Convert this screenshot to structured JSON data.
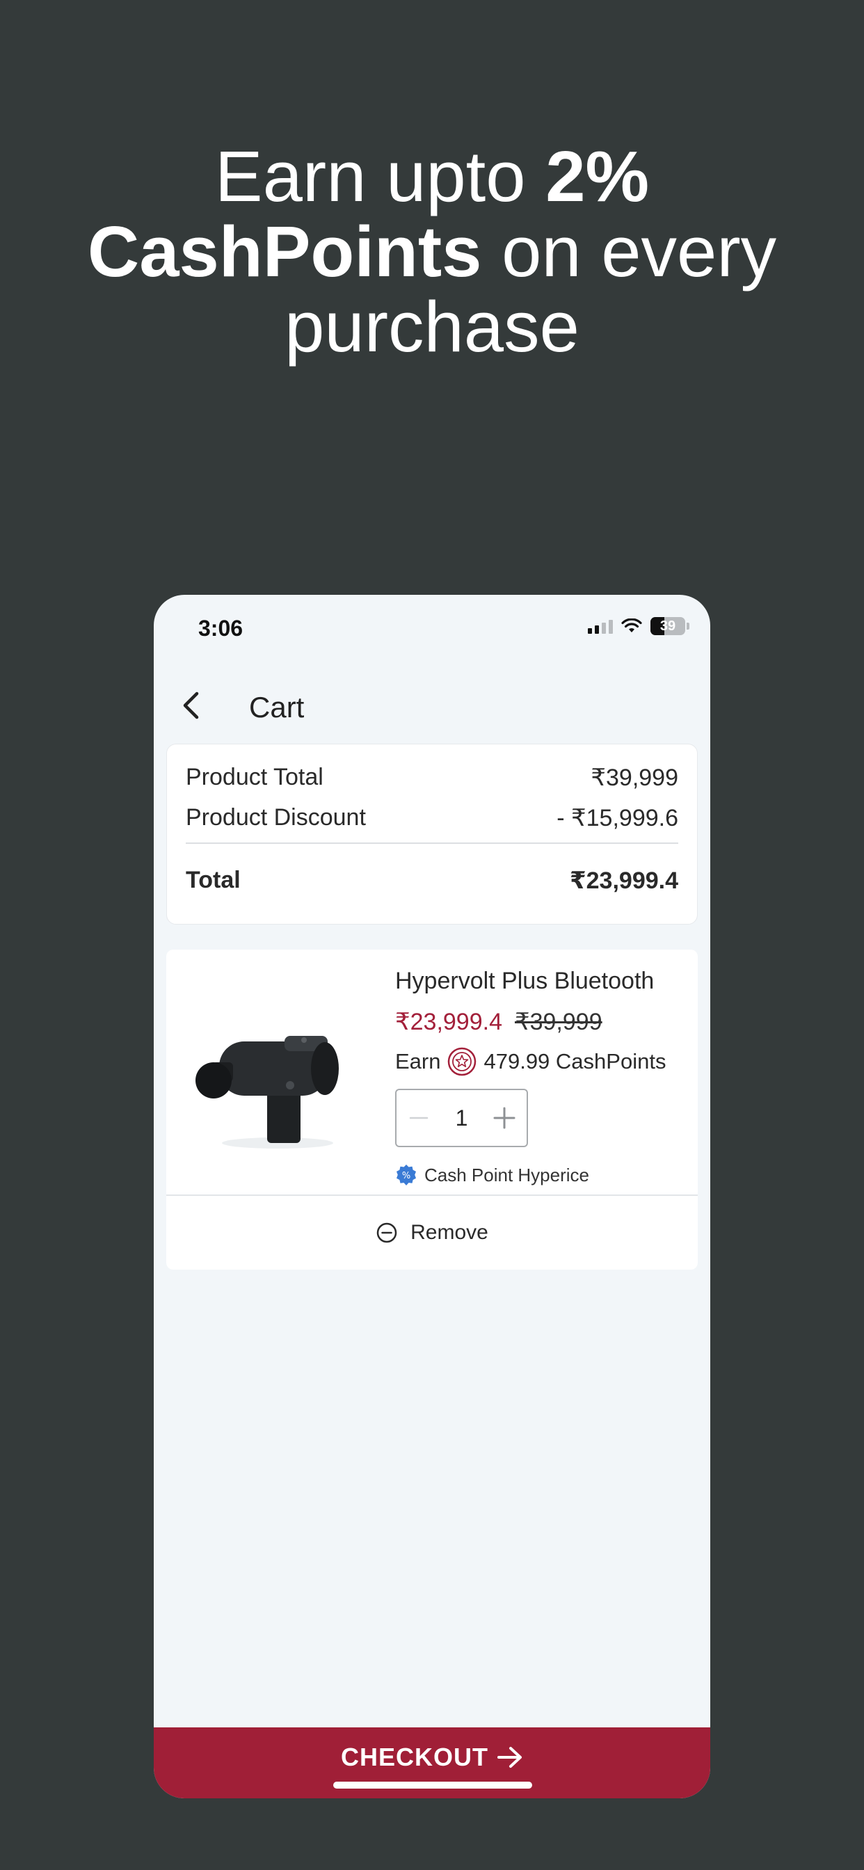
{
  "promo": {
    "part1": "Earn upto ",
    "bold1": "2%",
    "bold2": "CashPoints",
    "part2": " on every",
    "part3": "purchase"
  },
  "status_bar": {
    "time": "3:06",
    "battery": "39"
  },
  "header": {
    "title": "Cart"
  },
  "summary": {
    "rows": [
      {
        "label": "Product Total",
        "value": "₹39,999"
      },
      {
        "label": "Product Discount",
        "value": "- ₹15,999.6"
      }
    ],
    "total_label": "Total",
    "total_value": "₹23,999.4"
  },
  "cart_item": {
    "name": "Hypervolt Plus Bluetooth",
    "sale_price": "₹23,999.4",
    "original_price": "₹39,999",
    "earn_prefix": "Earn",
    "earn_value": "479.99 CashPoints",
    "quantity": "1",
    "offer": "Cash Point Hyperice",
    "remove_label": "Remove"
  },
  "checkout": {
    "label": "CHECKOUT"
  },
  "colors": {
    "background": "#343a3a",
    "brand": "#a01f37",
    "sale_price": "#a3203a",
    "offer_badge": "#3a7bd5"
  }
}
